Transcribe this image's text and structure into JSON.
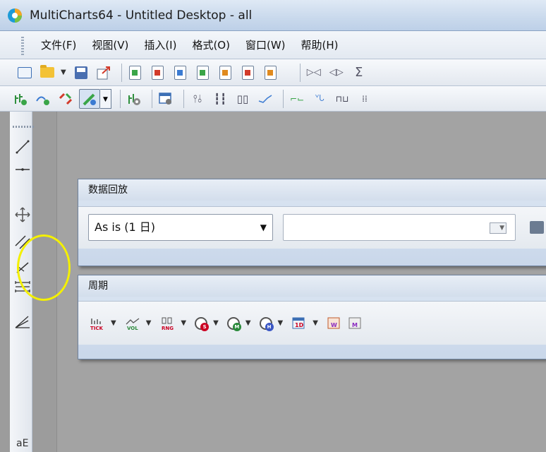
{
  "window": {
    "title": "MultiCharts64 - Untitled Desktop - all",
    "logo": "multicharts-logo-icon"
  },
  "menu": [
    {
      "label": "文件(F)"
    },
    {
      "label": "视图(V)"
    },
    {
      "label": "插入(I)"
    },
    {
      "label": "格式(O)"
    },
    {
      "label": "窗口(W)"
    },
    {
      "label": "帮助(H)"
    }
  ],
  "toolbar1": {
    "icons": [
      "new-window-icon",
      "open-folder-icon",
      "dropdown-arrow-icon",
      "save-icon",
      "export-icon",
      "chart-window-icon",
      "scanner-window-icon",
      "dom-window-icon",
      "formula-icon",
      "portfolio-icon",
      "news-icon",
      "report-icon",
      "play-icon",
      "compress-icon",
      "sigma-icon"
    ]
  },
  "toolbar2": {
    "icons": [
      "insert-study-icon",
      "insert-signal-icon",
      "format-signal-icon",
      "drawing-tool-icon",
      "dropdown-arrow-icon",
      "insert-indicator-icon",
      "window-settings-icon",
      "bar-style-icon",
      "candle-style-icon",
      "hollow-candle-icon",
      "line-style-icon",
      "point-figure-icon",
      "renko-icon",
      "kagi-icon",
      "range-icon"
    ]
  },
  "left_toolbar": {
    "tools": [
      "trend-line-icon",
      "horizontal-line-icon",
      "move-cross-icon",
      "parallel-lines-icon",
      "fibonacci-icon",
      "horizontal-lines-icon",
      "angle-icon",
      "text-icon"
    ]
  },
  "data_playback": {
    "title": "数据回放",
    "mode_value": "As is (1 日)",
    "date_value": ""
  },
  "period": {
    "title": "周期",
    "items": [
      {
        "label": "TICK",
        "icon": "tick-icon"
      },
      {
        "label": "VOL",
        "icon": "volume-icon"
      },
      {
        "label": "RNG",
        "icon": "range-icon"
      },
      {
        "label": "S",
        "icon": "seconds-icon"
      },
      {
        "label": "M",
        "icon": "minutes-icon"
      },
      {
        "label": "H",
        "icon": "hours-icon"
      },
      {
        "label": "1D",
        "icon": "days-icon"
      },
      {
        "label": "W",
        "icon": "weeks-icon"
      },
      {
        "label": "M",
        "icon": "months-icon"
      }
    ]
  },
  "colors": {
    "highlight": "#f4f000",
    "accent": "#3c6fb5"
  }
}
